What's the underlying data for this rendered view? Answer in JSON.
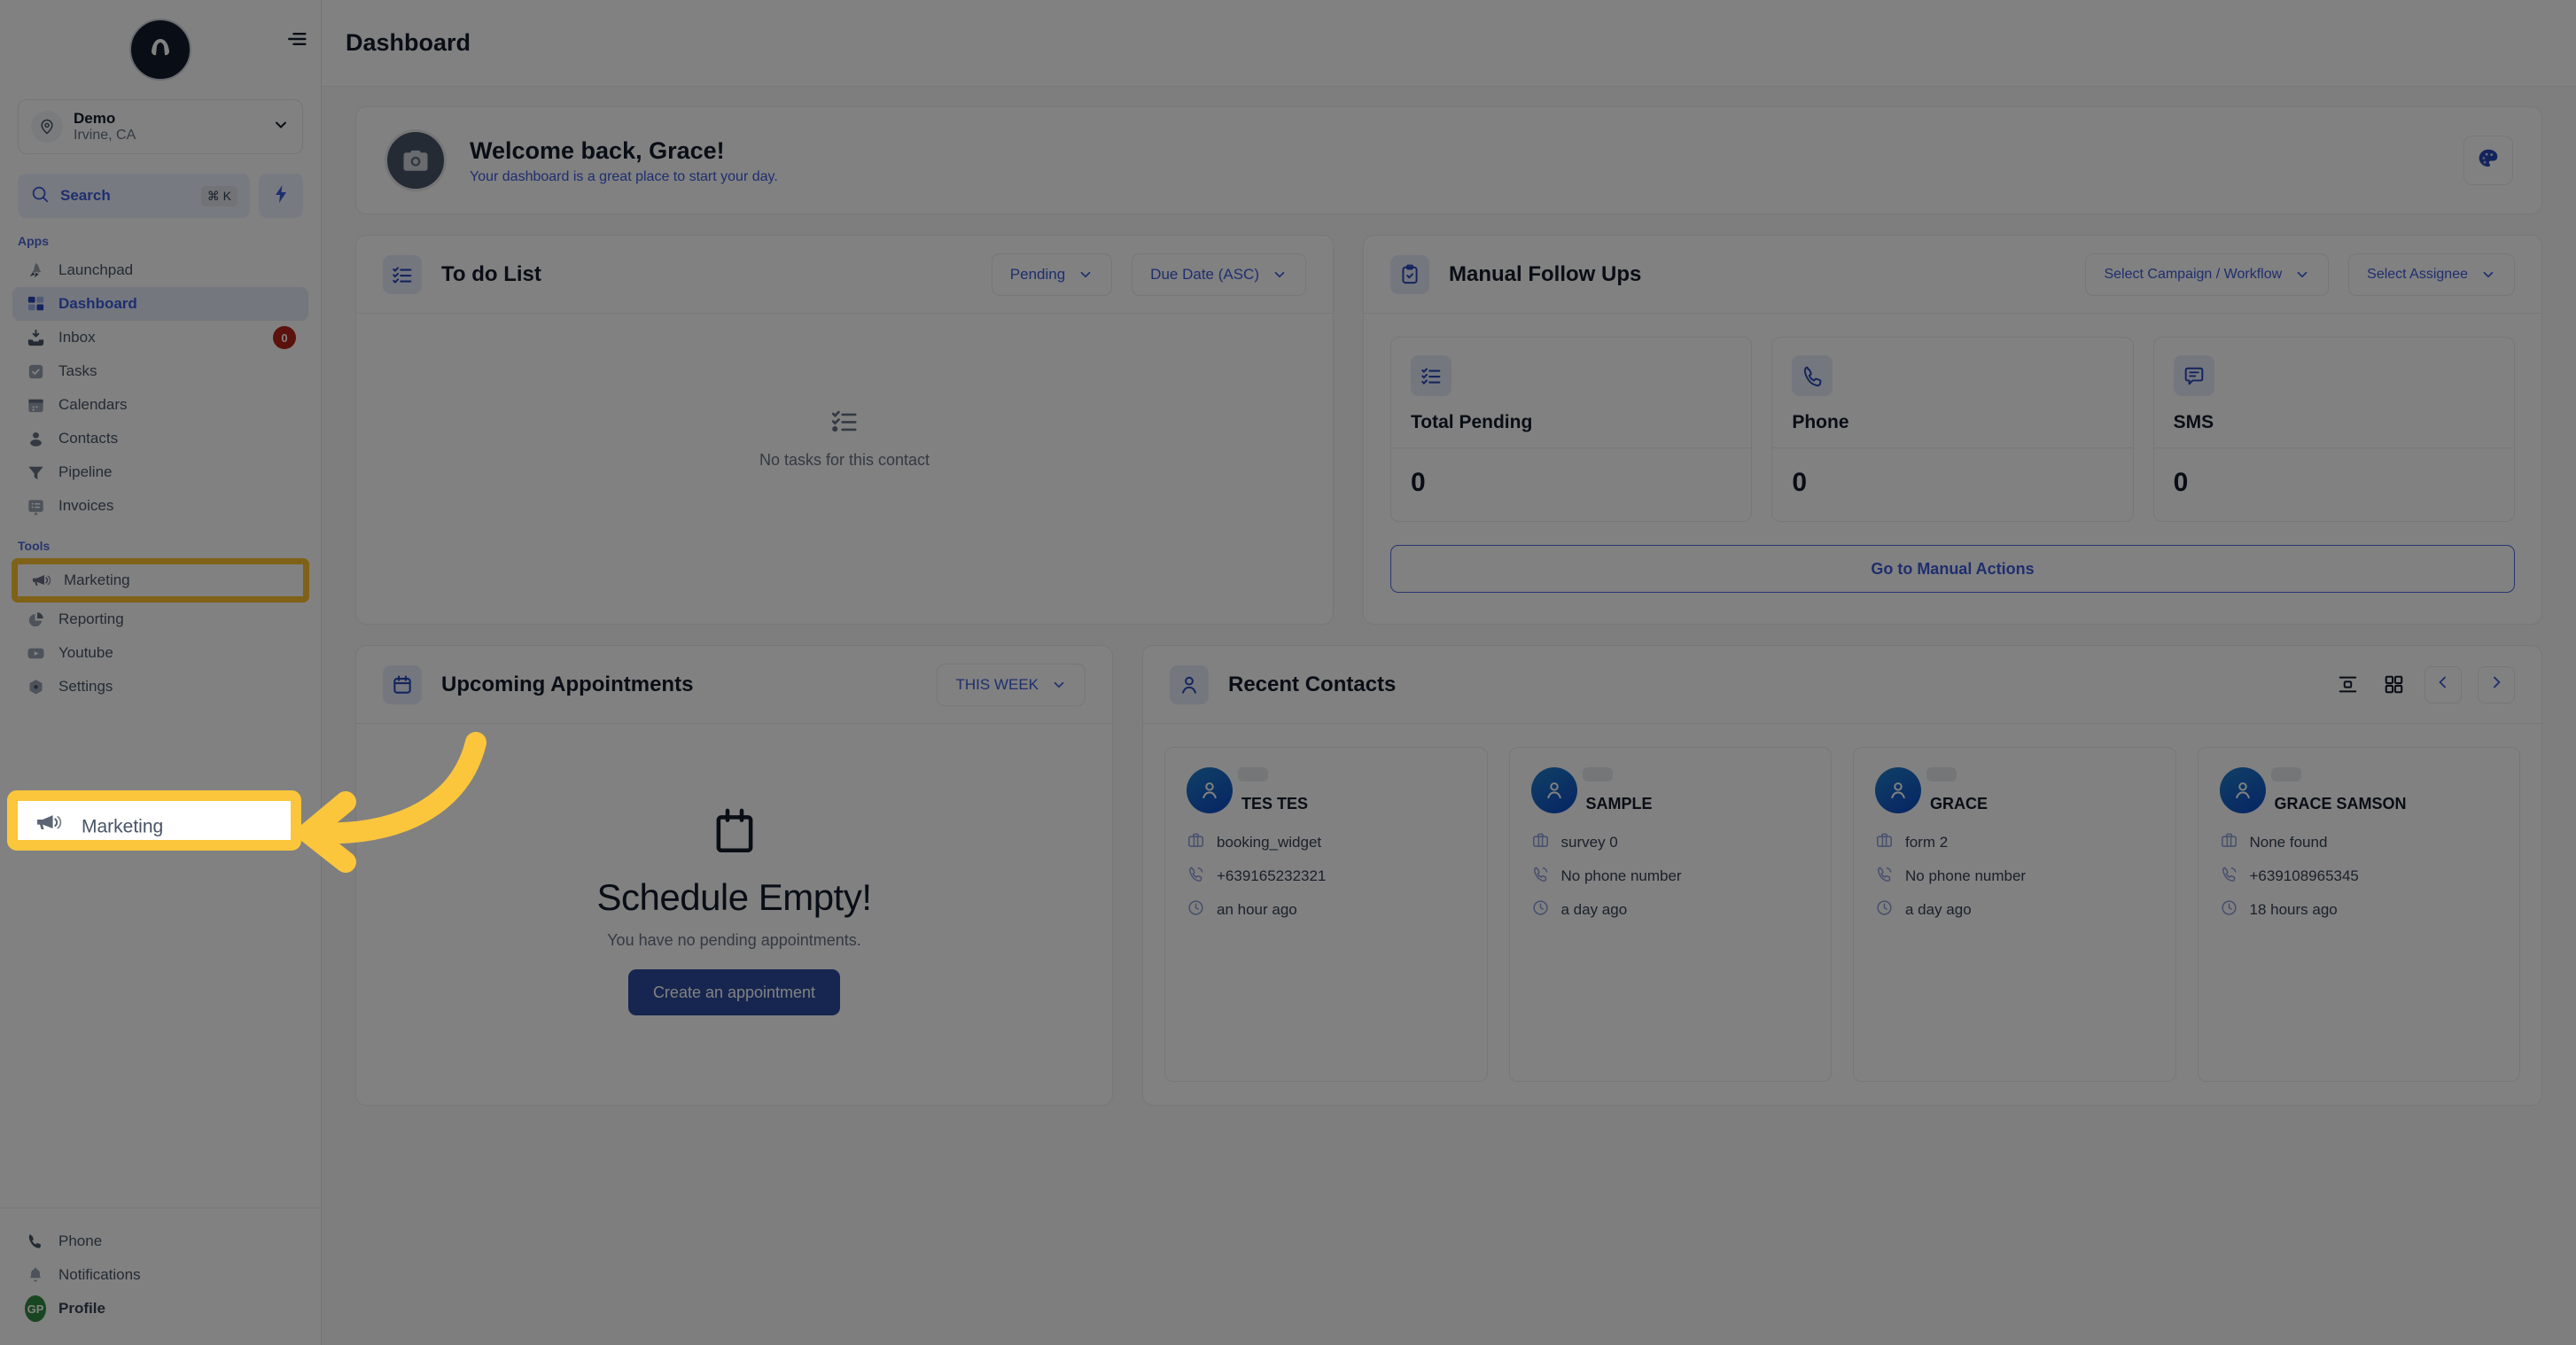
{
  "sidebar": {
    "logo_letter": "A",
    "location": {
      "name": "Demo",
      "sub": "Irvine, CA"
    },
    "search": {
      "label": "Search",
      "shortcut": "⌘ K"
    },
    "sections": [
      {
        "label": "Apps"
      },
      {
        "label": "Tools"
      }
    ],
    "apps": [
      {
        "label": "Launchpad",
        "icon": "launchpad-icon",
        "active": false,
        "badge": null
      },
      {
        "label": "Dashboard",
        "icon": "dashboard-icon",
        "active": true,
        "badge": null
      },
      {
        "label": "Inbox",
        "icon": "inbox-icon",
        "active": false,
        "badge": "0"
      },
      {
        "label": "Tasks",
        "icon": "tasks-icon",
        "active": false,
        "badge": null
      },
      {
        "label": "Calendars",
        "icon": "calendar-icon",
        "active": false,
        "badge": null
      },
      {
        "label": "Contacts",
        "icon": "contacts-icon",
        "active": false,
        "badge": null
      },
      {
        "label": "Pipeline",
        "icon": "pipeline-icon",
        "active": false,
        "badge": null
      },
      {
        "label": "Invoices",
        "icon": "invoices-icon",
        "active": false,
        "badge": null
      }
    ],
    "tools": [
      {
        "label": "Marketing",
        "icon": "megaphone-icon",
        "highlighted": true
      },
      {
        "label": "Reporting",
        "icon": "pie-chart-icon",
        "highlighted": false
      },
      {
        "label": "Youtube",
        "icon": "youtube-icon",
        "highlighted": false
      },
      {
        "label": "Settings",
        "icon": "gear-icon",
        "highlighted": false
      }
    ],
    "bottom": [
      {
        "label": "Phone",
        "icon": "phone-icon"
      },
      {
        "label": "Notifications",
        "icon": "bell-icon"
      },
      {
        "label": "Profile",
        "icon": "avatar",
        "initials": "GP"
      }
    ]
  },
  "topbar": {
    "title": "Dashboard",
    "collapse_icon": "collapse-sidebar-icon"
  },
  "welcome": {
    "title": "Welcome back, Grace!",
    "subtitle": "Your dashboard is a great place to start your day.",
    "avatar_icon": "camera-icon",
    "theme_icon": "palette-icon"
  },
  "todo": {
    "title": "To do List",
    "icon": "checklist-icon",
    "filter_status": "Pending",
    "filter_sort": "Due Date (ASC)",
    "empty_text": "No tasks for this contact"
  },
  "manual_follow_ups": {
    "title": "Manual Follow Ups",
    "icon": "clipboard-check-icon",
    "filter_campaign": "Select Campaign / Workflow",
    "filter_assignee": "Select Assignee",
    "stats": [
      {
        "name": "Total Pending",
        "value": "0",
        "icon": "checklist-icon"
      },
      {
        "name": "Phone",
        "value": "0",
        "icon": "phone-icon"
      },
      {
        "name": "SMS",
        "value": "0",
        "icon": "sms-icon"
      }
    ],
    "action_label": "Go to Manual Actions"
  },
  "appointments": {
    "title": "Upcoming Appointments",
    "icon": "calendar-icon",
    "range": "THIS WEEK",
    "empty_title": "Schedule Empty!",
    "empty_sub": "You have no pending appointments.",
    "cta_label": "Create an appointment"
  },
  "recent_contacts": {
    "title": "Recent Contacts",
    "icon": "user-icon",
    "view_list_icon": "list-view-icon",
    "view_grid_icon": "grid-view-icon",
    "prev_icon": "chevron-left-icon",
    "next_icon": "chevron-right-icon",
    "contacts": [
      {
        "name": "TES TES",
        "source": "booking_widget",
        "phone": "+639165232321",
        "time": "an hour ago"
      },
      {
        "name": "SAMPLE",
        "source": "survey 0",
        "phone": "No phone number",
        "time": "a day ago"
      },
      {
        "name": "GRACE",
        "source": "form 2",
        "phone": "No phone number",
        "time": "a day ago"
      },
      {
        "name": "GRACE SAMSON",
        "source": "None found",
        "phone": "+639108965345",
        "time": "18 hours ago"
      }
    ]
  },
  "annotation": {
    "highlight_target": "Marketing",
    "arrow_color": "#FBC63C",
    "highlight_color": "#FBC63C"
  },
  "colors": {
    "accent": "#3b5bdb",
    "primary_button": "#2c4a9e",
    "badge_red": "#b42318",
    "avatar_green": "#2f8a3f",
    "highlight_yellow": "#FBC63C"
  }
}
